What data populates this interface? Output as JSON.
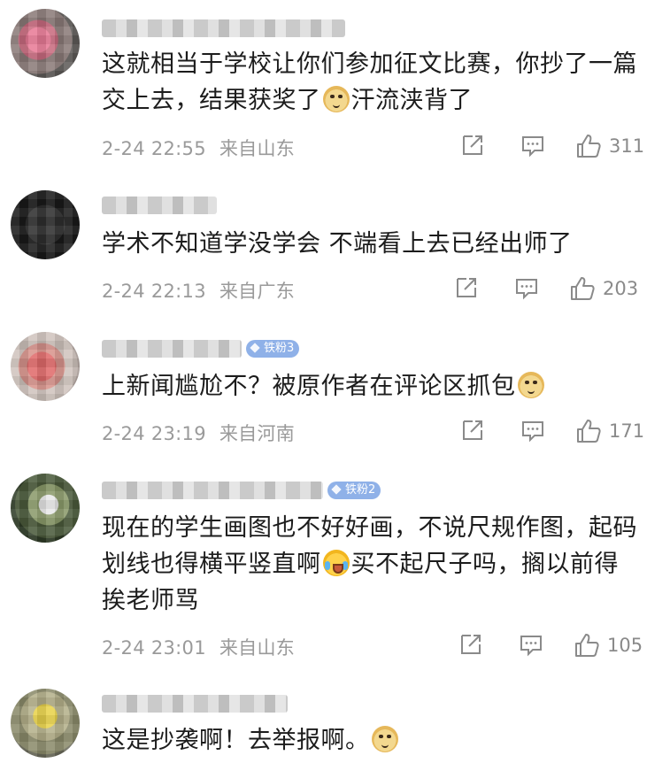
{
  "comments": [
    {
      "text_a": "这就相当于学校让你们参加征文比赛，你抄了一篇交上去，结果获奖了",
      "text_b": "汗流浃背了",
      "time": "2-24 22:55",
      "location": "来自山东",
      "likes": "311"
    },
    {
      "text": "学术不知道学没学会 不端看上去已经出师了",
      "time": "2-24 22:13",
      "location": "来自广东",
      "likes": "203"
    },
    {
      "fan_badge": "铁粉3",
      "text": "上新闻尴尬不？被原作者在评论区抓包",
      "time": "2-24 23:19",
      "location": "来自河南",
      "likes": "171"
    },
    {
      "fan_badge": "铁粉2",
      "text_a": "现在的学生画图也不好好画，不说尺规作图，起码划线也得横平竖直啊",
      "text_b": "买不起尺子吗，搁以前得挨老师骂",
      "time": "2-24 23:01",
      "location": "来自山东",
      "likes": "105"
    },
    {
      "text": "这是抄袭啊！去举报啊。"
    }
  ],
  "icons": {
    "share": "share-icon",
    "comment": "comment-icon",
    "like": "thumbs-up-icon",
    "emoji_doge": "doge-emoji-icon",
    "emoji_cry": "crying-laughing-emoji-icon"
  },
  "colors": {
    "text": "#1c1c1c",
    "meta": "#9a9a9a",
    "badge": "#8fb1e8"
  }
}
